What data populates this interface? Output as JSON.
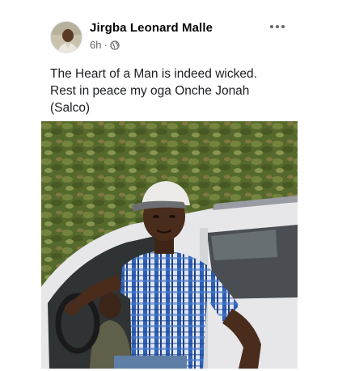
{
  "post": {
    "author_name": "Jirgba Leonard Malle",
    "timestamp": "6h",
    "separator": "·",
    "privacy_icon": "globe-icon",
    "more_icon": "more-horizontal-icon",
    "caption_lines": [
      "The Heart of a Man is indeed wicked.",
      "Rest in peace my oga Onche Jonah",
      "(Salco)"
    ],
    "photo_subject": "man-in-cap-beside-car"
  },
  "colors": {
    "secondary_text": "#65676b",
    "primary_text": "#1c1e21",
    "shirt_blue": "#3a63b8",
    "car_white": "#e9e9ec",
    "foliage": "#5a6e2e"
  }
}
